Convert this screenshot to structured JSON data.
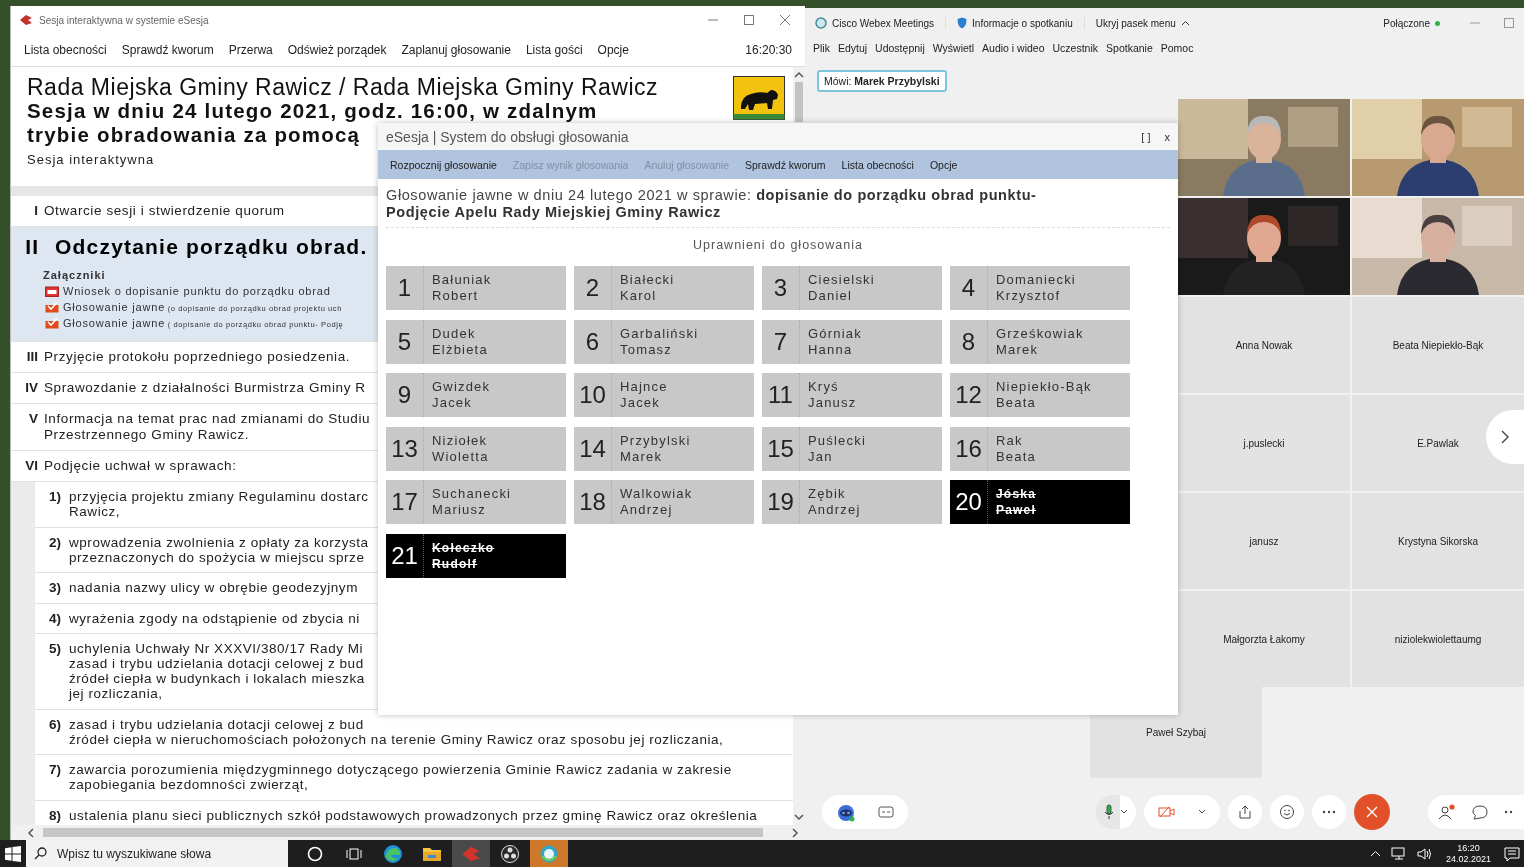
{
  "esesja_window": {
    "title": "Sesja interaktywna w systemie eSesja",
    "menu": [
      "Lista obecności",
      "Sprawdź kworum",
      "Przerwa",
      "Odśwież porządek",
      "Zaplanuj głosowanie",
      "Lista gości",
      "Opcje"
    ],
    "clock": "16:20:30",
    "header": {
      "council": "Rada Miejska Gminy Rawicz / Rada Miejska Gminy Rawicz",
      "session_lines": [
        "Sesja w dniu 24 lutego 2021, godz. 16:00, w zdalnym",
        "trybie obradowania za pomocą"
      ],
      "subtitle": "Sesja interaktywna"
    },
    "agenda": [
      {
        "number": "I",
        "title": "Otwarcie sesji i stwierdzenie quorum",
        "selected": false
      },
      {
        "number": "II",
        "title": "Odczytanie porządku obrad.",
        "selected": true,
        "attachments_label": "Załączniki",
        "attachments": [
          {
            "kind": "document",
            "name": "Wniosek o dopisanie punktu do porządku obrad"
          },
          {
            "kind": "vote",
            "name": "Głosowanie jawne",
            "note": "(o dopisanie do porządku obrad projektu uch"
          },
          {
            "kind": "vote",
            "name": "Głosowanie jawne",
            "note": "( dopisanie do porządku obrad punktu- Podję"
          }
        ]
      },
      {
        "number": "III",
        "title": "Przyjęcie protokołu poprzedniego posiedzenia.",
        "selected": false
      },
      {
        "number": "IV",
        "title": "Sprawozdanie z działalności Burmistrza Gminy R",
        "selected": false
      },
      {
        "number": "V",
        "title": "Informacja na temat prac nad zmianami do Studiu\nPrzestrzennego Gminy Rawicz.",
        "selected": false
      },
      {
        "number": "VI",
        "title": "Podjęcie uchwał w sprawach:",
        "selected": false,
        "children": [
          {
            "number": "1)",
            "text": "przyjęcia projektu zmiany Regulaminu dostarc\nRawicz,"
          },
          {
            "number": "2)",
            "text": "wprowadzenia zwolnienia z opłaty za korzysta\nprzeznaczonych do spożycia w miejscu sprze"
          },
          {
            "number": "3)",
            "text": "nadania nazwy ulicy w obrębie geodezyjnym"
          },
          {
            "number": "4)",
            "text": "wyrażenia zgody na odstąpienie od zbycia ni"
          },
          {
            "number": "5)",
            "text": "uchylenia Uchwały Nr XXXVI/380/17 Rady Mi\nzasad i trybu udzielania dotacji celowej z bud\nźródeł ciepła w budynkach i lokalach mieszka\njej rozliczania,"
          },
          {
            "number": "6)",
            "text": "zasad i trybu udzielania dotacji celowej z bud\nźródeł ciepła w nieruchomościach położonych na terenie Gminy Rawicz oraz sposobu jej rozliczania,"
          },
          {
            "number": "7)",
            "text": "zawarcia porozumienia międzygminnego dotyczącego powierzenia Gminie Rawicz zadania w zakresie\nzapobiegania bezdomności zwierząt,"
          },
          {
            "number": "8)",
            "text": "ustalenia planu sieci publicznych szkół podstawowych prowadzonych przez gminę Rawicz oraz określenia"
          }
        ]
      }
    ]
  },
  "voting_dialog": {
    "title": "eSesja | System do obsługi głosowania",
    "window_buttons": [
      "[ ]",
      "x"
    ],
    "menu": [
      {
        "label": "Rozpocznij głosowanie",
        "disabled": false
      },
      {
        "label": "Zapisz wynik głosowania",
        "disabled": true
      },
      {
        "label": "Anuluj głosowanie",
        "disabled": true
      },
      {
        "label": "Sprawdź kworum",
        "disabled": false
      },
      {
        "label": "Lista obecności",
        "disabled": false
      },
      {
        "label": "Opcje",
        "disabled": false
      }
    ],
    "heading": "Głosowanie jawne w dniu 24 lutego 2021 w sprawie: **dopisanie do porządku obrad punktu- Podjęcie Apelu Rady Miejskiej Gminy Rawicz**",
    "section_label": "Uprawnieni do głosowania",
    "voters": [
      {
        "number": "1",
        "surname": "Bałuniak",
        "first_name": "Robert",
        "absent": false
      },
      {
        "number": "2",
        "surname": "Białecki",
        "first_name": "Karol",
        "absent": false
      },
      {
        "number": "3",
        "surname": "Ciesielski",
        "first_name": "Daniel",
        "absent": false
      },
      {
        "number": "4",
        "surname": "Domaniecki",
        "first_name": "Krzysztof",
        "absent": false
      },
      {
        "number": "5",
        "surname": "Dudek",
        "first_name": "Elżbieta",
        "absent": false
      },
      {
        "number": "6",
        "surname": "Garbaliński",
        "first_name": "Tomasz",
        "absent": false
      },
      {
        "number": "7",
        "surname": "Górniak",
        "first_name": "Hanna",
        "absent": false
      },
      {
        "number": "8",
        "surname": "Grześkowiak",
        "first_name": "Marek",
        "absent": false
      },
      {
        "number": "9",
        "surname": "Gwizdek",
        "first_name": "Jacek",
        "absent": false
      },
      {
        "number": "10",
        "surname": "Hajnce",
        "first_name": "Jacek",
        "absent": false
      },
      {
        "number": "11",
        "surname": "Kryś",
        "first_name": "Janusz",
        "absent": false
      },
      {
        "number": "12",
        "surname": "Niepiekło-Bąk",
        "first_name": "Beata",
        "absent": false
      },
      {
        "number": "13",
        "surname": "Niziołek",
        "first_name": "Wioletta",
        "absent": false
      },
      {
        "number": "14",
        "surname": "Przybylski",
        "first_name": "Marek",
        "absent": false
      },
      {
        "number": "15",
        "surname": "Puślecki",
        "first_name": "Jan",
        "absent": false
      },
      {
        "number": "16",
        "surname": "Rak",
        "first_name": "Beata",
        "absent": false
      },
      {
        "number": "17",
        "surname": "Suchanecki",
        "first_name": "Mariusz",
        "absent": false
      },
      {
        "number": "18",
        "surname": "Walkowiak",
        "first_name": "Andrzej",
        "absent": false
      },
      {
        "number": "19",
        "surname": "Zębik",
        "first_name": "Andrzej",
        "absent": false
      },
      {
        "number": "20",
        "surname": "Jóska",
        "first_name": "Paweł",
        "absent": true
      },
      {
        "number": "21",
        "surname": "Kołeczko",
        "first_name": "Rudolf",
        "absent": true
      }
    ]
  },
  "webex_window": {
    "app_name": "Cisco Webex Meetings",
    "meeting_info": "Informacje o spotkaniu",
    "hide_menu": "Ukryj pasek menu",
    "status": "Połączone",
    "menu": [
      "Plik",
      "Edytuj",
      "Udostępnij",
      "Wyświetl",
      "Audio i wideo",
      "Uczestnik",
      "Spotkanie",
      "Pomoc"
    ],
    "speaker": "Mówi: **Marek Przybylski**",
    "participants": [
      "Anna Nowak",
      "Beata Niepiekło-Bąk",
      "j.puslecki",
      "E.Pawlak",
      "janusz",
      "Krystyna Sikorska",
      "Małgorzta Łakomy",
      "niziolekwiolettaumg"
    ],
    "extra_participant": "Paweł Szybaj"
  },
  "taskbar": {
    "search_placeholder": "Wpisz tu wyszukiwane słowa",
    "apps": [
      {
        "kind": "cortana",
        "active": false,
        "flashing": false
      },
      {
        "kind": "task-view",
        "active": false,
        "flashing": false
      },
      {
        "kind": "edge",
        "active": false,
        "flashing": false
      },
      {
        "kind": "explorer",
        "active": false,
        "flashing": false
      },
      {
        "kind": "esesja",
        "active": true,
        "flashing": false
      },
      {
        "kind": "obs",
        "active": false,
        "flashing": false
      },
      {
        "kind": "webex",
        "active": false,
        "flashing": true
      }
    ],
    "time": "16:20",
    "date": "24.02.2021"
  }
}
